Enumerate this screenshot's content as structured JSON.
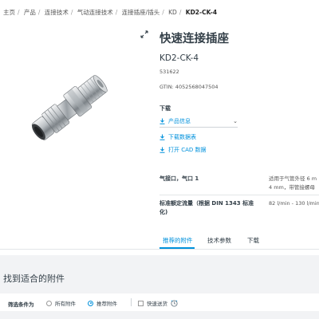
{
  "breadcrumb": [
    "主页",
    "产品",
    "连接技术",
    "气动连接技术",
    "连接插座/插头",
    "KD",
    "KD2-CK-4"
  ],
  "product": {
    "title": "快速连接插座",
    "model": "KD2-CK-4",
    "part_number": "531622",
    "gtin": "GTIN: 4052568047504"
  },
  "downloads": {
    "title": "下载",
    "items": [
      {
        "label": "产品信息",
        "icon": "download-icon",
        "has_dropdown": true
      },
      {
        "label": "下载数据表",
        "icon": "download-icon"
      },
      {
        "label": "打开 CAD 数据",
        "icon": "download-icon"
      }
    ]
  },
  "specs": [
    {
      "label": "气接口，气口 1",
      "value_lines": [
        "适用于气管外径 6 m",
        "4 mm，带管接螺母"
      ]
    },
    {
      "label_lines": [
        "标准额定流量（根据 DIN 1343 标准",
        "化)"
      ],
      "value_lines": [
        "82 l/min - 130 l/min"
      ]
    }
  ],
  "tabs": [
    {
      "label": "推荐的附件",
      "active": true
    },
    {
      "label": "技术参数",
      "active": false
    },
    {
      "label": "下载",
      "active": false
    }
  ],
  "accessories": {
    "heading": "找到适合的附件",
    "filter_label": "筛选条件为",
    "options": [
      {
        "label": "所有附件",
        "selected": false
      },
      {
        "label": "推荐附件",
        "selected": true
      }
    ],
    "checkbox_label": "快速送货",
    "checkbox_icon": "clock-icon"
  },
  "colors": {
    "accent": "#0091dc",
    "text": "#333f48",
    "section_bg": "#f2f3f5"
  }
}
